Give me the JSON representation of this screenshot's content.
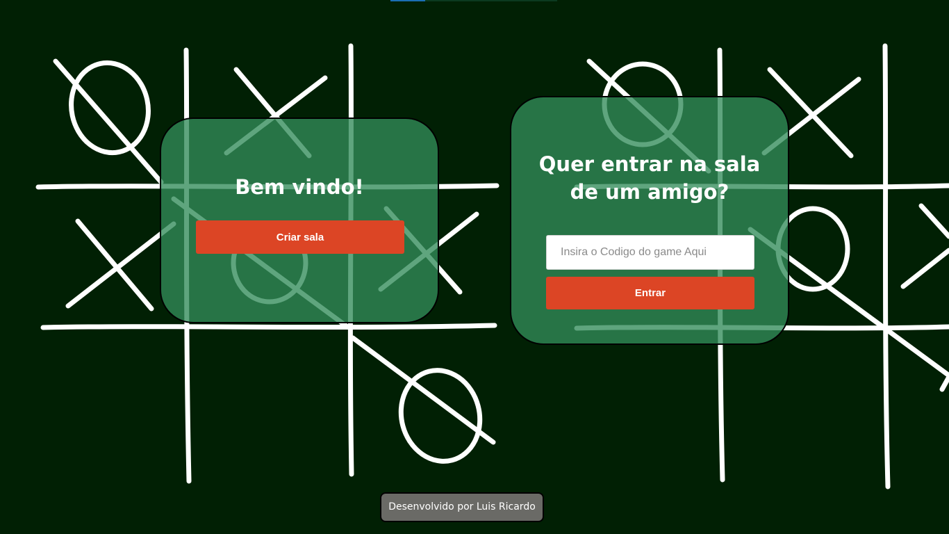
{
  "create_card": {
    "title": "Bem vindo!",
    "button_label": "Criar sala"
  },
  "join_card": {
    "title": "Quer entrar na sala de um amigo?",
    "input_value": "",
    "input_placeholder": "Insira o Codigo do game Aqui",
    "button_label": "Entrar"
  },
  "footer": {
    "credit": "Desenvolvido por Luis Ricardo"
  },
  "colors": {
    "background": "#012004",
    "card": "#328c5a",
    "button": "#dc4525",
    "footer": "#6a6a66"
  },
  "background_art": {
    "description_icon": "tic-tac-toe-board-icon"
  }
}
